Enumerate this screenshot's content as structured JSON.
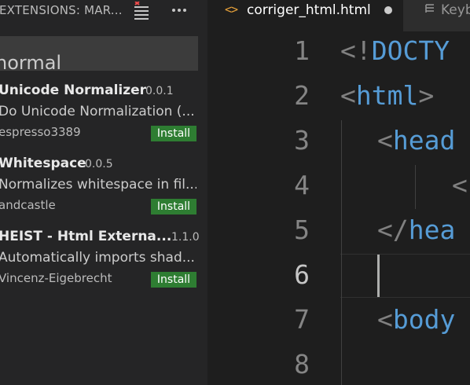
{
  "sidebar": {
    "title": "EXTENSIONS: MAR...",
    "search": {
      "value": "normal"
    },
    "extensions": [
      {
        "name": "Unicode Normalizer",
        "version": "0.0.1",
        "description": "Do Unicode Normalization (...",
        "author": "espresso3389",
        "action": "Install"
      },
      {
        "name": "Whitespace",
        "version": "0.0.5",
        "description": "Normalizes whitespace in fil...",
        "author": "andcastle",
        "action": "Install"
      },
      {
        "name": "HEIST - Html Externa...",
        "version": "1.1.0",
        "description": "Automatically imports shad...",
        "author": "Vincenz-Eigebrecht",
        "action": "Install"
      }
    ]
  },
  "editor": {
    "tabs": [
      {
        "label": "corriger_html.html",
        "icon": "<>"
      },
      {
        "label": "Keybi"
      }
    ],
    "line_numbers": [
      "1",
      "2",
      "3",
      "4",
      "5",
      "6",
      "7",
      "8"
    ],
    "active_line": "6",
    "lines": [
      {
        "punc": "<!",
        "tag": "DOCTY"
      },
      {
        "punc": "<",
        "tag": "html",
        "punc2": ">"
      },
      {
        "punc": "<",
        "tag": "head"
      },
      {
        "punc": "<"
      },
      {
        "punc": "</",
        "tag": "hea"
      },
      {},
      {
        "punc": "<",
        "tag": "body"
      },
      {}
    ]
  },
  "colors": {
    "accent_green": "#2e7d32",
    "tag_blue": "#569cd6",
    "html_icon_orange": "#e8a23a"
  }
}
